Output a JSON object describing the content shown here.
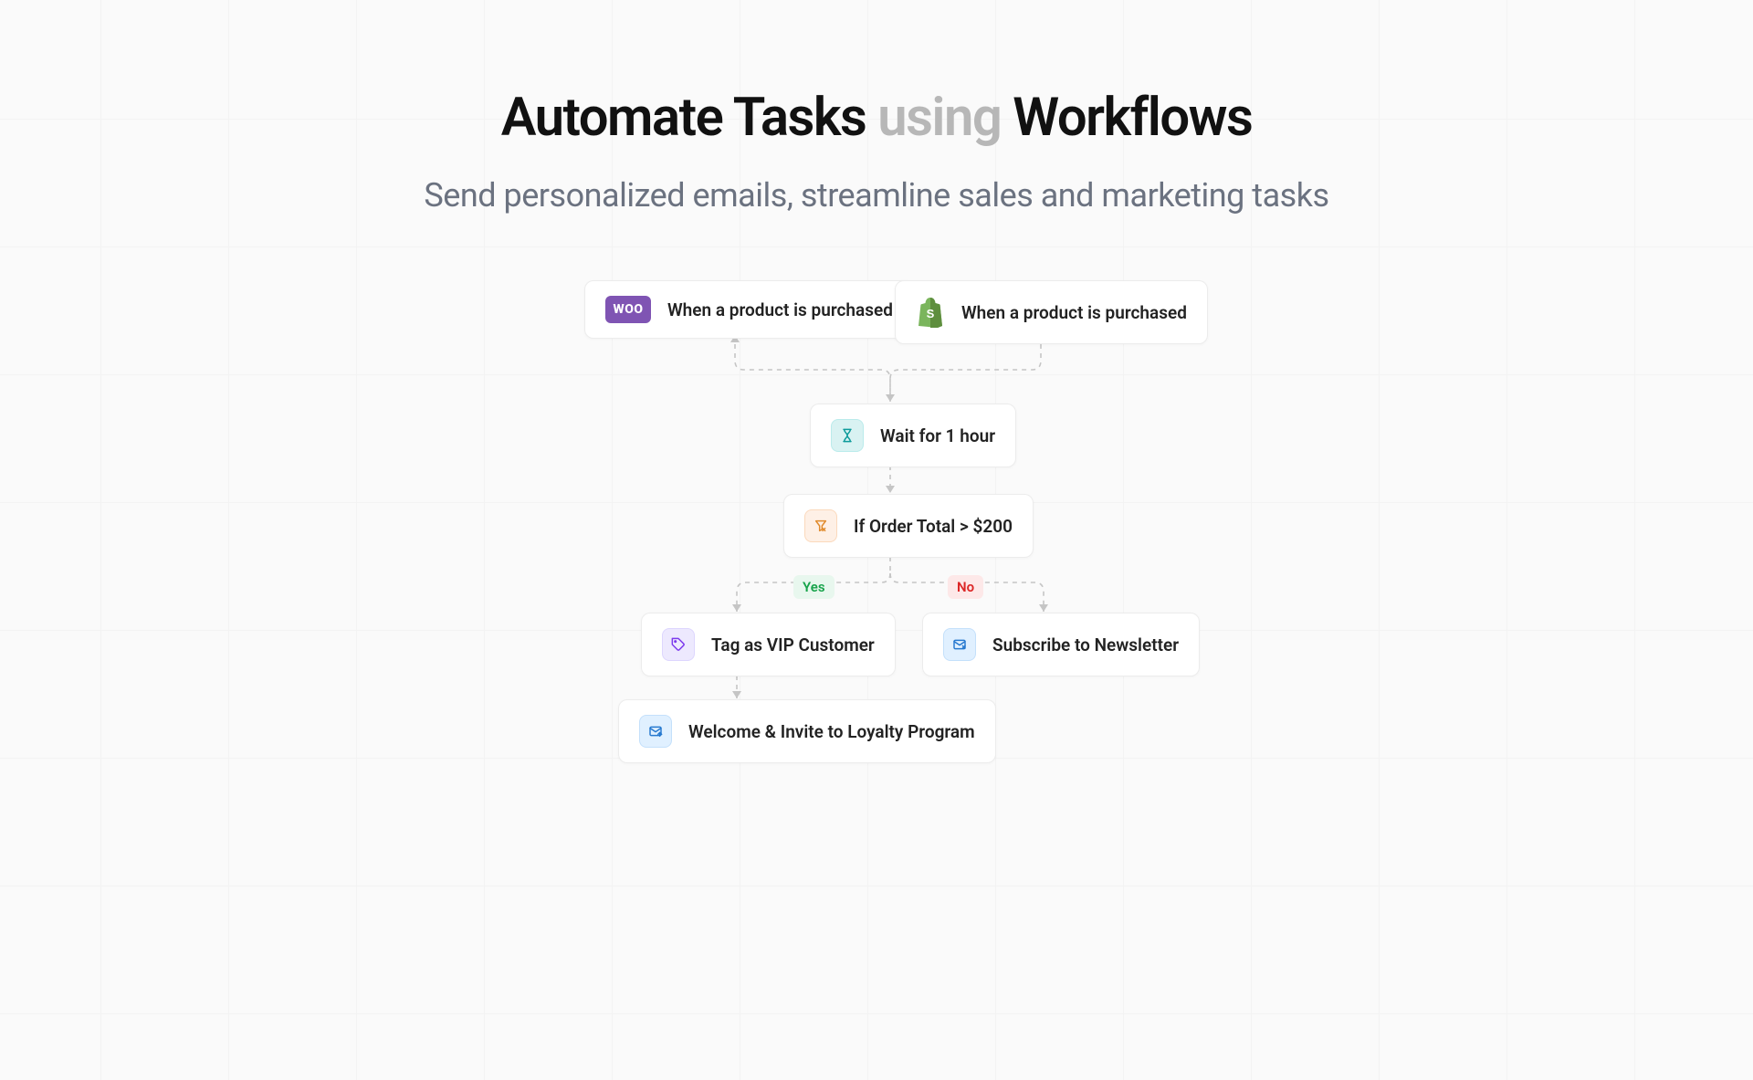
{
  "heading": {
    "pre": "Automate Tasks ",
    "muted": "using",
    "post": " Workflows"
  },
  "subtitle": "Send personalized emails, streamline sales and marketing tasks",
  "nodes": {
    "woo": "When a product is purchased",
    "shopify": "When a product is purchased",
    "wait": "Wait for 1 hour",
    "condition": "If Order Total > $200",
    "tag_vip": "Tag as VIP Customer",
    "subscribe": "Subscribe to Newsletter",
    "welcome": "Welcome & Invite to Loyalty Program"
  },
  "badges": {
    "yes": "Yes",
    "no": "No"
  }
}
